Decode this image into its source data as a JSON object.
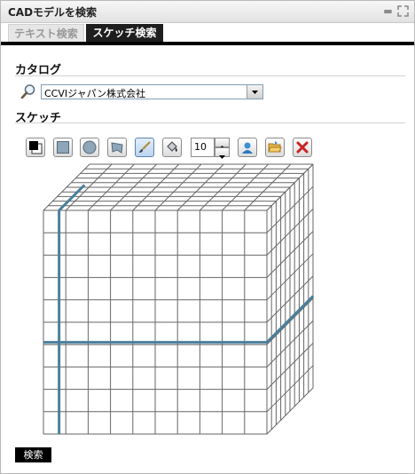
{
  "window": {
    "title": "CADモデルを検索",
    "minimize_icon": "minimize-icon",
    "expand_icon": "expand-icon"
  },
  "tabs": [
    {
      "label": "テキスト検索",
      "active": false
    },
    {
      "label": "スケッチ検索",
      "active": true
    }
  ],
  "catalog": {
    "heading": "カタログ",
    "search_icon": "magnifier-icon",
    "selected": "CCVIジャパン株式会社"
  },
  "sketch": {
    "heading": "スケッチ",
    "toolbar": [
      {
        "name": "color-picker-tool",
        "icon": "color-swatch-icon"
      },
      {
        "name": "square-shape-tool",
        "icon": "square-icon"
      },
      {
        "name": "circle-shape-tool",
        "icon": "circle-icon"
      },
      {
        "name": "free-shape-tool",
        "icon": "shape-icon"
      },
      {
        "name": "brush-tool",
        "icon": "brush-icon",
        "active": true
      },
      {
        "name": "fill-tool",
        "icon": "paint-bucket-icon"
      },
      {
        "name": "person-tool",
        "icon": "person-icon"
      },
      {
        "name": "open-folder-tool",
        "icon": "folder-icon"
      },
      {
        "name": "clear-tool",
        "icon": "close-icon"
      }
    ],
    "brush_size": "10",
    "grid_cells": 10
  },
  "actions": {
    "search_label": "検索"
  },
  "colors": {
    "tab_active_bg": "#1e1e1e",
    "grid_line": "#666666",
    "stroke": "#4a7f9c",
    "clear_red": "#cc2222"
  }
}
